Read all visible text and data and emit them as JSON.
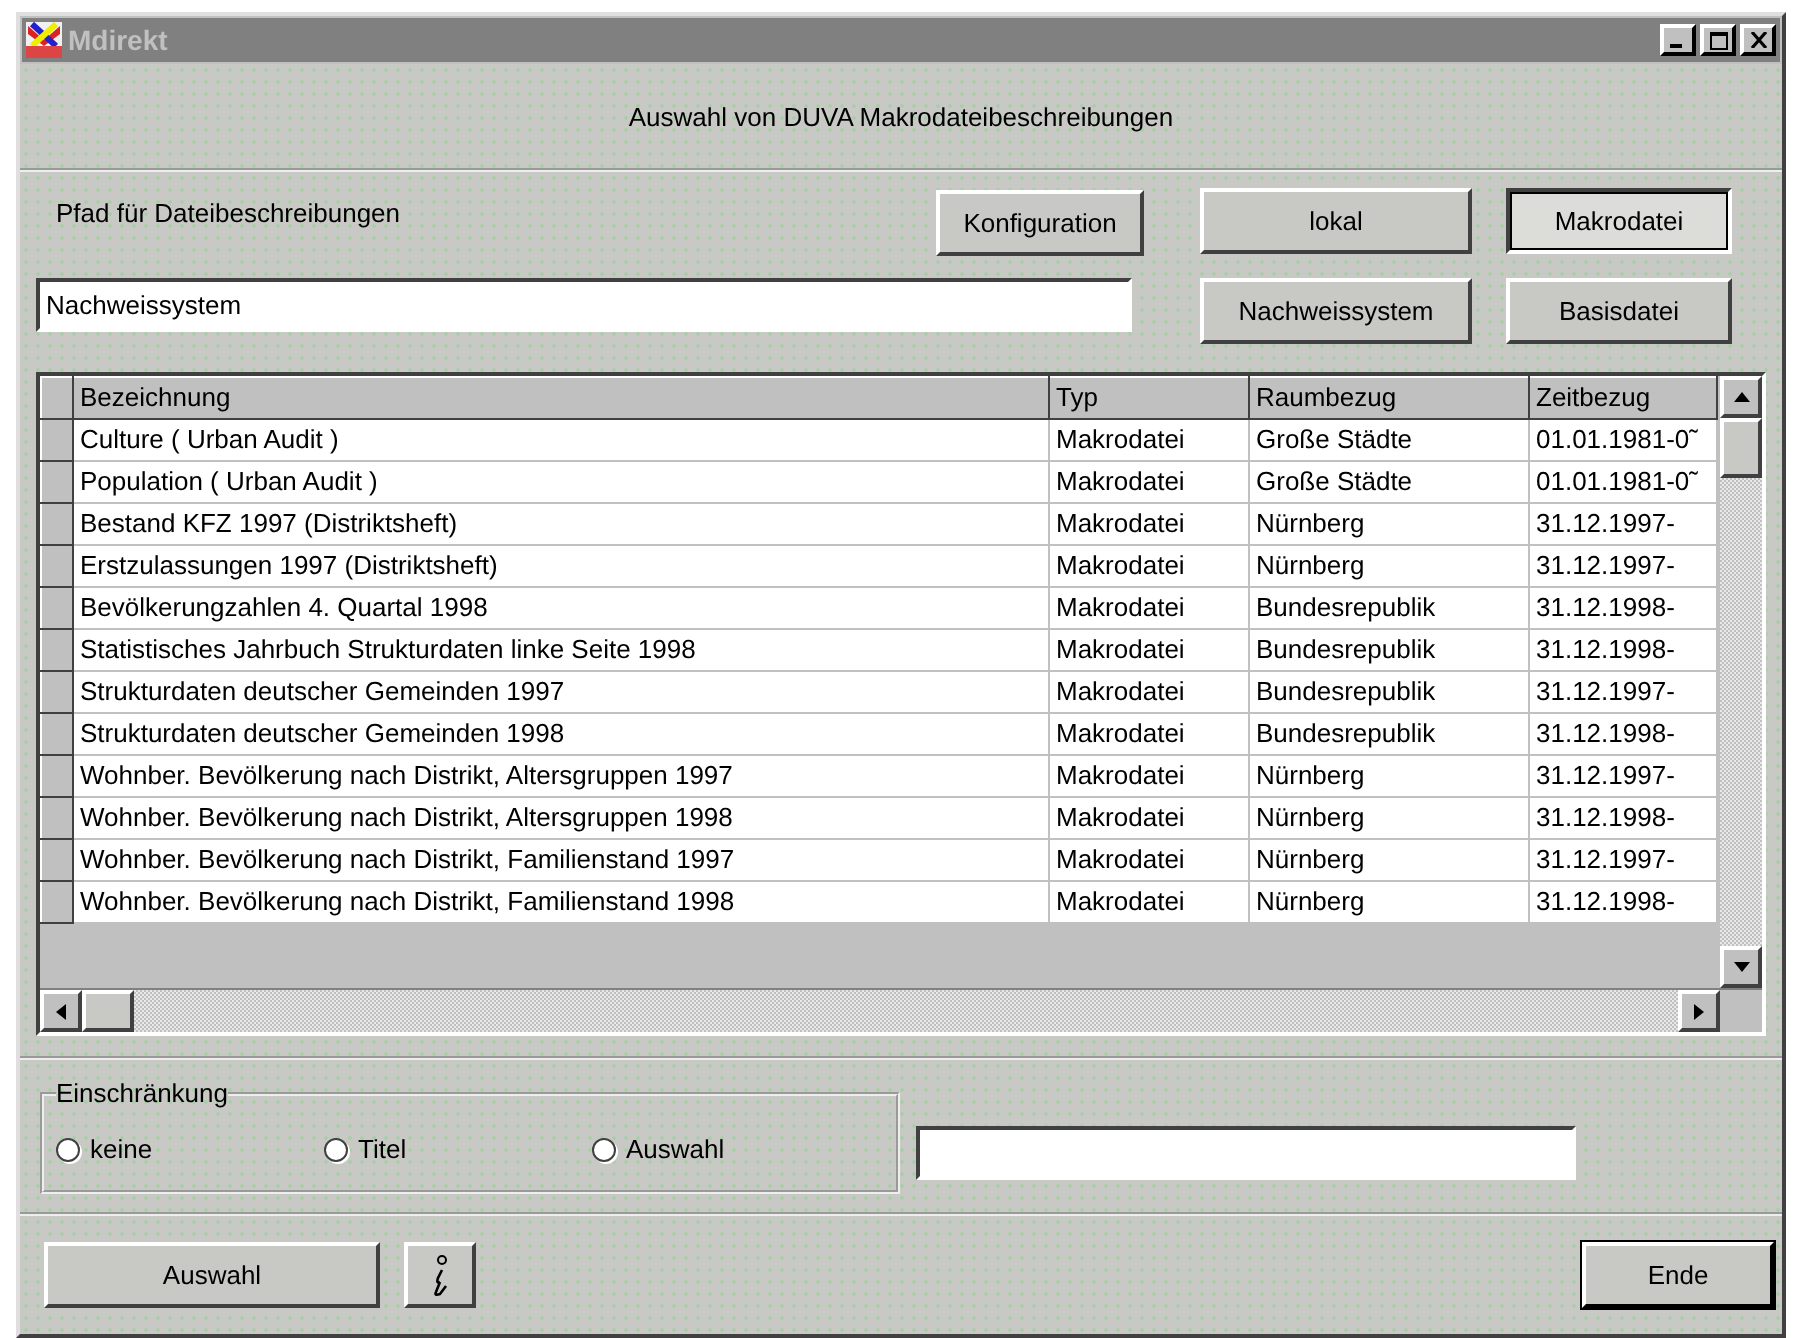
{
  "window": {
    "title": "Mdirekt"
  },
  "header": {
    "title": "Auswahl von DUVA Makrodateibeschreibungen"
  },
  "path": {
    "label": "Pfad für Dateibeschreibungen",
    "value": "Nachweissystem",
    "config_button": "Konfiguration"
  },
  "toggles": [
    {
      "label": "lokal",
      "selected": false
    },
    {
      "label": "Makrodatei",
      "selected": true
    },
    {
      "label": "Nachweissystem",
      "selected": false
    },
    {
      "label": "Basisdatei",
      "selected": false
    }
  ],
  "table": {
    "columns": [
      "Bezeichnung",
      "Typ",
      "Raumbezug",
      "Zeitbezug"
    ],
    "rows": [
      [
        "Culture  ( Urban Audit )",
        "Makrodatei",
        "Große Städte",
        "01.01.1981-0˜"
      ],
      [
        "Population   ( Urban Audit )",
        "Makrodatei",
        "Große Städte",
        "01.01.1981-0˜"
      ],
      [
        "Bestand KFZ 1997 (Distriktsheft)",
        "Makrodatei",
        "Nürnberg",
        "31.12.1997-"
      ],
      [
        "Erstzulassungen 1997 (Distriktsheft)",
        "Makrodatei",
        "Nürnberg",
        "31.12.1997-"
      ],
      [
        "Bevölkerungzahlen 4. Quartal 1998",
        "Makrodatei",
        "Bundesrepublik",
        "31.12.1998-"
      ],
      [
        "Statistisches Jahrbuch Strukturdaten linke Seite 1998",
        "Makrodatei",
        "Bundesrepublik",
        "31.12.1998-"
      ],
      [
        "Strukturdaten deutscher Gemeinden 1997",
        "Makrodatei",
        "Bundesrepublik",
        "31.12.1997-"
      ],
      [
        "Strukturdaten deutscher Gemeinden 1998",
        "Makrodatei",
        "Bundesrepublik",
        "31.12.1998-"
      ],
      [
        "Wohnber. Bevölkerung nach Distrikt, Altersgruppen 1997",
        "Makrodatei",
        "Nürnberg",
        "31.12.1997-"
      ],
      [
        "Wohnber. Bevölkerung nach Distrikt, Altersgruppen 1998",
        "Makrodatei",
        "Nürnberg",
        "31.12.1998-"
      ],
      [
        "Wohnber. Bevölkerung nach Distrikt, Familienstand 1997",
        "Makrodatei",
        "Nürnberg",
        "31.12.1997-"
      ],
      [
        "Wohnber. Bevölkerung nach Distrikt, Familienstand 1998",
        "Makrodatei",
        "Nürnberg",
        "31.12.1998-"
      ]
    ]
  },
  "restriction": {
    "title": "Einschränkung",
    "options": [
      {
        "label": "keine",
        "checked": false
      },
      {
        "label": "Titel",
        "checked": false
      },
      {
        "label": "Auswahl",
        "checked": false
      }
    ]
  },
  "footer": {
    "select_button": "Auswahl",
    "end_button": "Ende"
  }
}
